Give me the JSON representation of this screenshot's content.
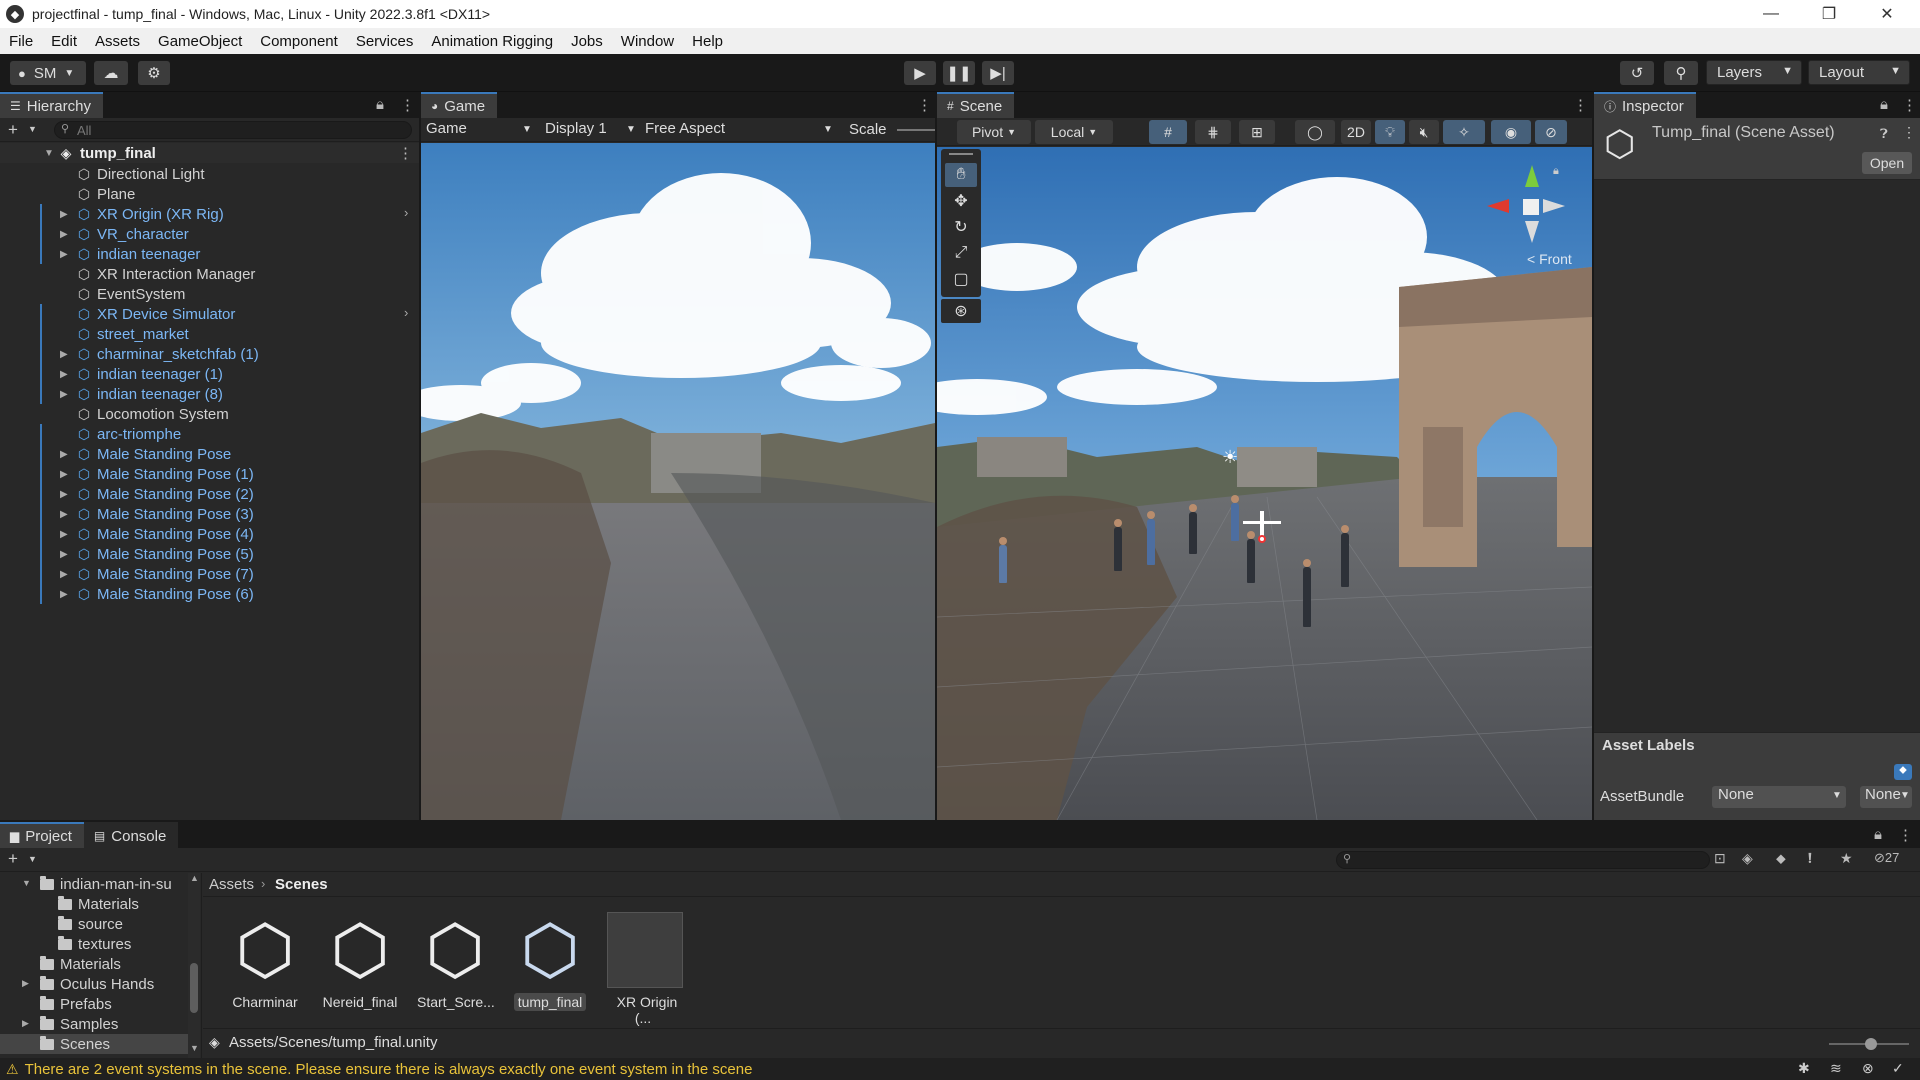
{
  "window": {
    "title": "projectfinal - tump_final - Windows, Mac, Linux - Unity 2022.3.8f1 <DX11>",
    "minimize": "—",
    "restore": "❐",
    "close": "✕"
  },
  "menu": [
    "File",
    "Edit",
    "Assets",
    "GameObject",
    "Component",
    "Services",
    "Animation Rigging",
    "Jobs",
    "Window",
    "Help"
  ],
  "toolbar": {
    "account": "SM",
    "layers": "Layers",
    "layout": "Layout"
  },
  "hierarchy": {
    "tab": "Hierarchy",
    "search_placeholder": "All",
    "scene": "tump_final",
    "items": [
      {
        "label": "Directional Light",
        "prefab": false,
        "expandable": false,
        "more": false
      },
      {
        "label": "Plane",
        "prefab": false,
        "expandable": false,
        "more": false
      },
      {
        "label": "XR Origin (XR Rig)",
        "prefab": true,
        "expandable": true,
        "more": true
      },
      {
        "label": "VR_character",
        "prefab": true,
        "expandable": true,
        "more": false
      },
      {
        "label": "indian teenager",
        "prefab": true,
        "expandable": true,
        "more": false
      },
      {
        "label": "XR Interaction Manager",
        "prefab": false,
        "expandable": false,
        "more": false
      },
      {
        "label": "EventSystem",
        "prefab": false,
        "expandable": false,
        "more": false
      },
      {
        "label": "XR Device Simulator",
        "prefab": true,
        "expandable": false,
        "more": true
      },
      {
        "label": "street_market",
        "prefab": true,
        "expandable": false,
        "more": false
      },
      {
        "label": "charminar_sketchfab (1)",
        "prefab": true,
        "expandable": true,
        "more": false
      },
      {
        "label": "indian teenager (1)",
        "prefab": true,
        "expandable": true,
        "more": false
      },
      {
        "label": "indian teenager (8)",
        "prefab": true,
        "expandable": true,
        "more": false
      },
      {
        "label": "Locomotion System",
        "prefab": false,
        "expandable": false,
        "more": false
      },
      {
        "label": "arc-triomphe",
        "prefab": true,
        "expandable": false,
        "more": false
      },
      {
        "label": "Male Standing Pose",
        "prefab": true,
        "expandable": true,
        "more": false
      },
      {
        "label": "Male Standing Pose (1)",
        "prefab": true,
        "expandable": true,
        "more": false
      },
      {
        "label": "Male Standing Pose (2)",
        "prefab": true,
        "expandable": true,
        "more": false
      },
      {
        "label": "Male Standing Pose (3)",
        "prefab": true,
        "expandable": true,
        "more": false
      },
      {
        "label": "Male Standing Pose (4)",
        "prefab": true,
        "expandable": true,
        "more": false
      },
      {
        "label": "Male Standing Pose (5)",
        "prefab": true,
        "expandable": true,
        "more": false
      },
      {
        "label": "Male Standing Pose (7)",
        "prefab": true,
        "expandable": true,
        "more": false
      },
      {
        "label": "Male Standing Pose (6)",
        "prefab": true,
        "expandable": true,
        "more": false
      }
    ]
  },
  "game": {
    "tab": "Game",
    "mode": "Game",
    "display": "Display 1",
    "aspect": "Free Aspect",
    "scale": "Scale"
  },
  "scene": {
    "tab": "Scene",
    "pivot": "Pivot",
    "local": "Local",
    "twod": "2D",
    "gizmo_label": "< Front"
  },
  "inspector": {
    "tab": "Inspector",
    "title": "Tump_final (Scene Asset)",
    "open": "Open",
    "asset_labels": "Asset Labels",
    "assetbundle_label": "AssetBundle",
    "assetbundle_value": "None",
    "variant_value": "None"
  },
  "project": {
    "tabs": [
      "Project",
      "Console"
    ],
    "tree": [
      {
        "label": "indian-man-in-su",
        "indent": 1,
        "expanded": true
      },
      {
        "label": "Materials",
        "indent": 2,
        "expanded": false
      },
      {
        "label": "source",
        "indent": 2,
        "expanded": false
      },
      {
        "label": "textures",
        "indent": 2,
        "expanded": false
      },
      {
        "label": "Materials",
        "indent": 1,
        "expanded": false
      },
      {
        "label": "Oculus Hands",
        "indent": 1,
        "expanded": false,
        "arrow": true
      },
      {
        "label": "Prefabs",
        "indent": 1,
        "expanded": false
      },
      {
        "label": "Samples",
        "indent": 1,
        "expanded": false,
        "arrow": true
      },
      {
        "label": "Scenes",
        "indent": 1,
        "expanded": false,
        "selected": true
      }
    ],
    "breadcrumb": [
      "Assets",
      "Scenes"
    ],
    "assets": [
      {
        "label": "Charminar",
        "selected": false
      },
      {
        "label": "Nereid_final",
        "selected": false
      },
      {
        "label": "Start_Scre...",
        "selected": false
      },
      {
        "label": "tump_final",
        "selected": true
      },
      {
        "label": "XR Origin (...",
        "selected": false
      }
    ],
    "path": "Assets/Scenes/tump_final.unity",
    "hidden_count": "27"
  },
  "status": {
    "message": "There are 2 event systems in the scene. Please ensure there is always exactly one event system in the scene"
  },
  "colors": {
    "accent": "#3a79bb",
    "prefab_text": "#7cb7f5",
    "warning": "#e8c23a"
  }
}
